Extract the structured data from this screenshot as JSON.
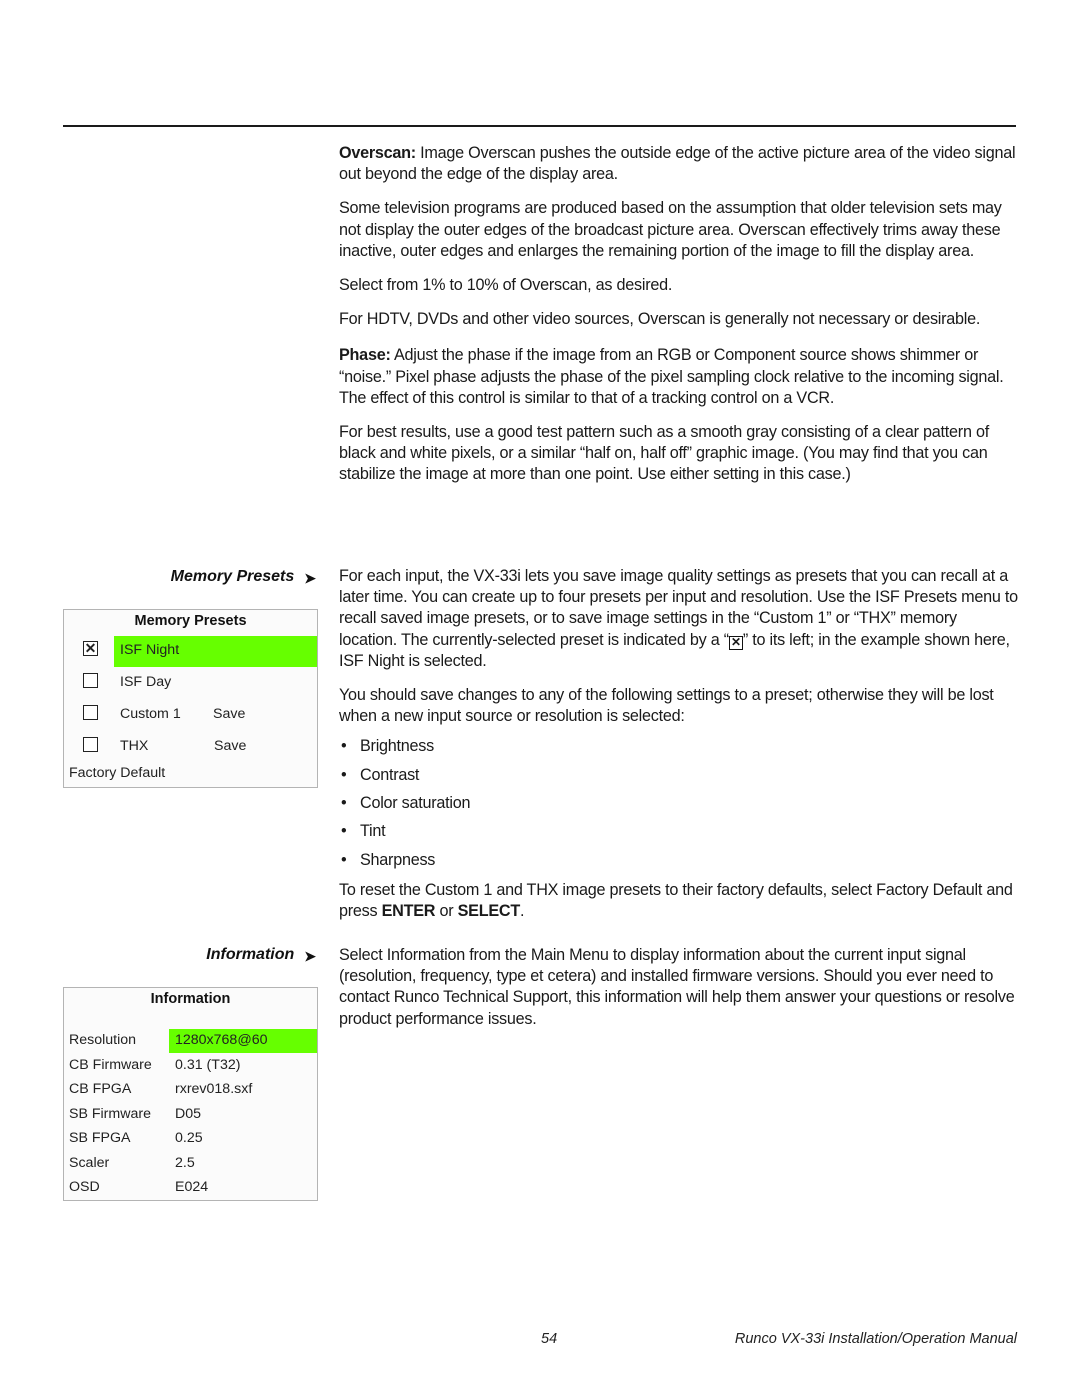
{
  "overscan": {
    "lead": "Overscan:",
    "p1_rest": " Image Overscan pushes the outside edge of the active picture area of the video signal out beyond the edge of the display area.",
    "p2": "Some television programs are produced based on the assumption that older television sets may not display the outer edges of the broadcast picture area. Overscan effectively trims away these inactive, outer edges and enlarges the remaining portion of the image to fill the display area.",
    "p3": "Select from 1% to 10% of Overscan, as desired.",
    "p4": "For HDTV, DVDs and other video sources, Overscan is generally not necessary or desirable."
  },
  "phase": {
    "lead": "Phase:",
    "p1_rest": " Adjust the phase if the image from an RGB or Component source shows shimmer or “noise.” Pixel phase adjusts the phase of the pixel sampling clock relative to the incoming signal. The effect of this control is similar to that of a tracking control on a VCR.",
    "p2": "For best results, use a good test pattern such as a smooth gray consisting of a clear pattern of black and white pixels, or a similar “half on, half off” graphic image. (You may find that you can stabilize the image at more than one point. Use either setting in this case.)"
  },
  "memory_presets": {
    "side_heading": "Memory Presets",
    "arrow_glyph": "➤",
    "p1_before": "For each input, the VX-33i lets you save image quality settings as presets that you can recall at a later time. You can create up to four presets per input and resolution. Use the ISF Presets menu to recall saved image presets, or to save image settings in the “Custom 1” or “THX” memory location. The currently-selected preset is indicated by a “",
    "p1_glyph": "✕",
    "p1_after": "” to its left; in the example shown here, ISF Night is selected.",
    "p2": "You should save changes to any of the following settings to a preset; otherwise they will be lost when a new input source or resolution is selected:",
    "bullets": [
      "Brightness",
      "Contrast",
      "Color saturation",
      "Tint",
      "Sharpness"
    ],
    "p3_before": "To reset the Custom 1 and THX image presets to their factory defaults, select Factory Default and press ",
    "p3_key1": "ENTER",
    "p3_mid": " or ",
    "p3_key2": "SELECT",
    "p3_end": ".",
    "menu": {
      "title": "Memory Presets",
      "highlight_color": "#66ff00",
      "items": [
        {
          "label": "ISF Night",
          "checked": true,
          "check_glyph": "✕",
          "action": ""
        },
        {
          "label": "ISF Day",
          "checked": false,
          "check_glyph": "",
          "action": ""
        },
        {
          "label": "Custom 1",
          "checked": false,
          "check_glyph": "",
          "action": "Save"
        },
        {
          "label": "THX",
          "checked": false,
          "check_glyph": "",
          "action": "Save"
        }
      ],
      "footer_item": "Factory Default"
    }
  },
  "information": {
    "side_heading": "Information",
    "arrow_glyph": "➤",
    "p1": "Select Information from the Main Menu to display information about the current input signal (resolution, frequency, type et cetera) and installed firmware versions. Should you ever need to contact Runco Technical Support, this information will help them answer your questions or resolve product performance issues.",
    "menu": {
      "title": "Information",
      "highlight_color": "#66ff00",
      "rows": [
        {
          "label": "Resolution",
          "value": "1280x768@60"
        },
        {
          "label": "CB Firmware",
          "value": "0.31 (T32)"
        },
        {
          "label": "CB FPGA",
          "value": "rxrev018.sxf"
        },
        {
          "label": "SB Firmware",
          "value": "D05"
        },
        {
          "label": "SB FPGA",
          "value": "0.25"
        },
        {
          "label": "Scaler",
          "value": "2.5"
        },
        {
          "label": "OSD",
          "value": "E024"
        }
      ]
    }
  },
  "footer": {
    "page_number": "54",
    "manual_title": "Runco VX-33i Installation/Operation Manual"
  }
}
